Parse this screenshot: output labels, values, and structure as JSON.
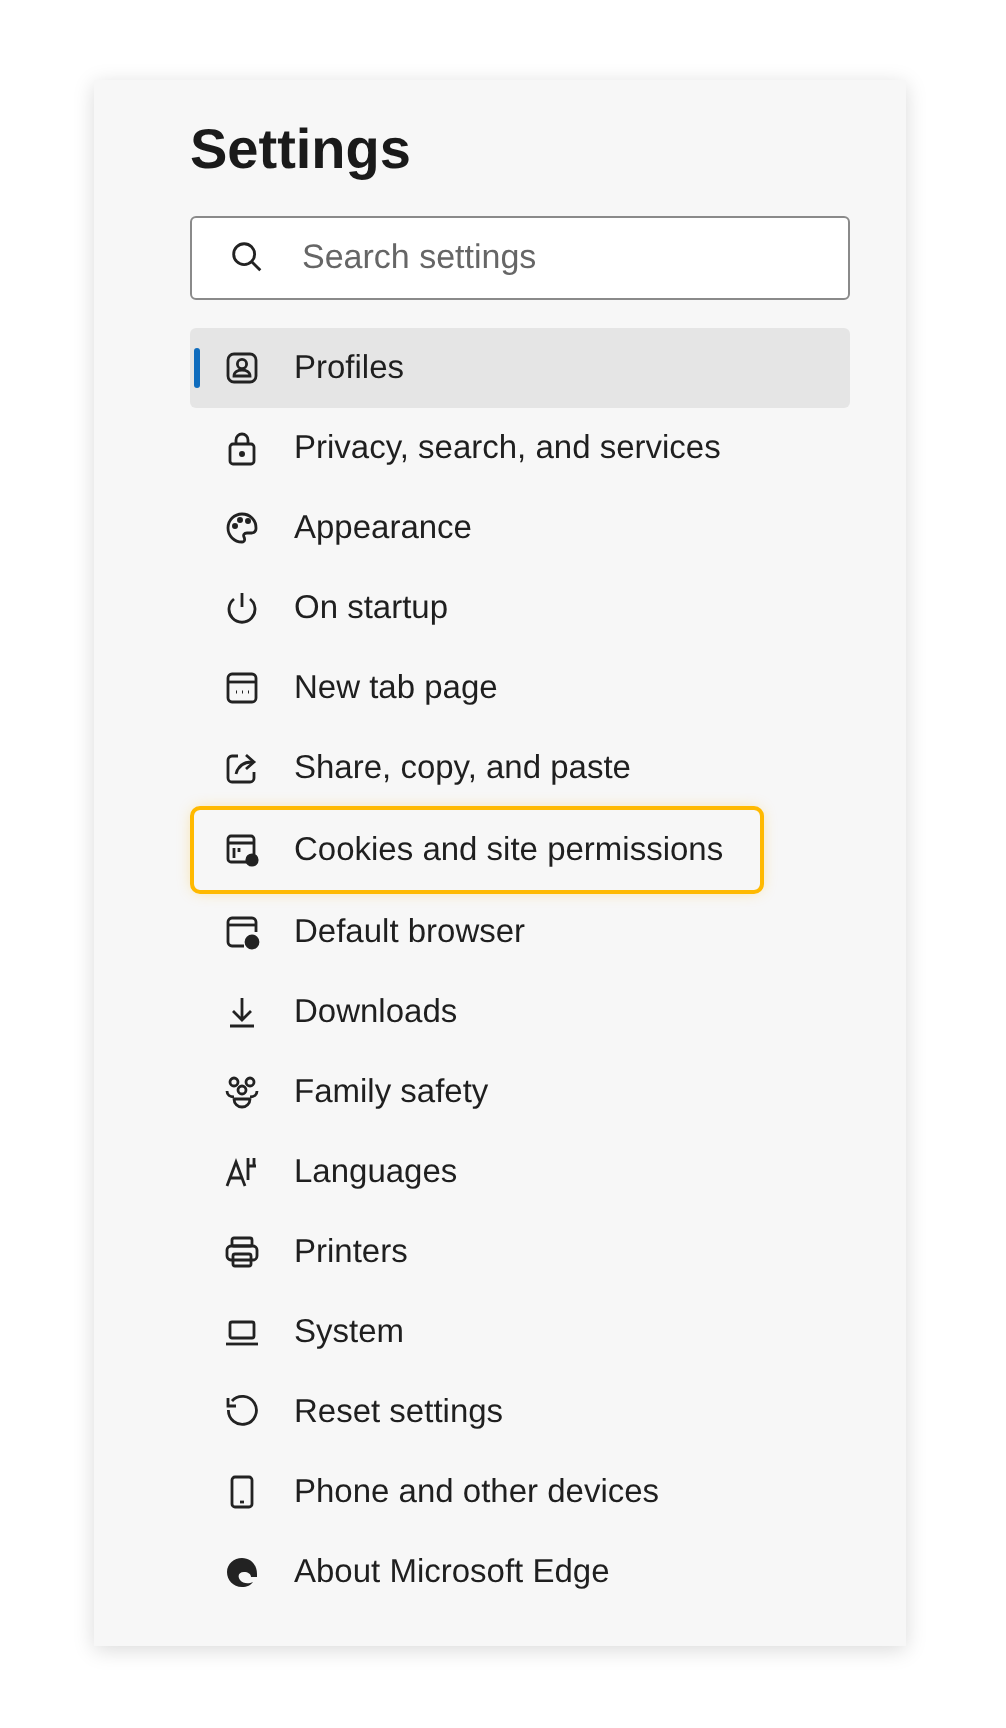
{
  "title": "Settings",
  "search": {
    "placeholder": "Search settings"
  },
  "items": [
    {
      "label": "Profiles",
      "selected": true,
      "highlighted": false
    },
    {
      "label": "Privacy, search, and services",
      "selected": false,
      "highlighted": false
    },
    {
      "label": "Appearance",
      "selected": false,
      "highlighted": false
    },
    {
      "label": "On startup",
      "selected": false,
      "highlighted": false
    },
    {
      "label": "New tab page",
      "selected": false,
      "highlighted": false
    },
    {
      "label": "Share, copy, and paste",
      "selected": false,
      "highlighted": false
    },
    {
      "label": "Cookies and site permissions",
      "selected": false,
      "highlighted": true
    },
    {
      "label": "Default browser",
      "selected": false,
      "highlighted": false
    },
    {
      "label": "Downloads",
      "selected": false,
      "highlighted": false
    },
    {
      "label": "Family safety",
      "selected": false,
      "highlighted": false
    },
    {
      "label": "Languages",
      "selected": false,
      "highlighted": false
    },
    {
      "label": "Printers",
      "selected": false,
      "highlighted": false
    },
    {
      "label": "System",
      "selected": false,
      "highlighted": false
    },
    {
      "label": "Reset settings",
      "selected": false,
      "highlighted": false
    },
    {
      "label": "Phone and other devices",
      "selected": false,
      "highlighted": false
    },
    {
      "label": "About Microsoft Edge",
      "selected": false,
      "highlighted": false
    }
  ]
}
